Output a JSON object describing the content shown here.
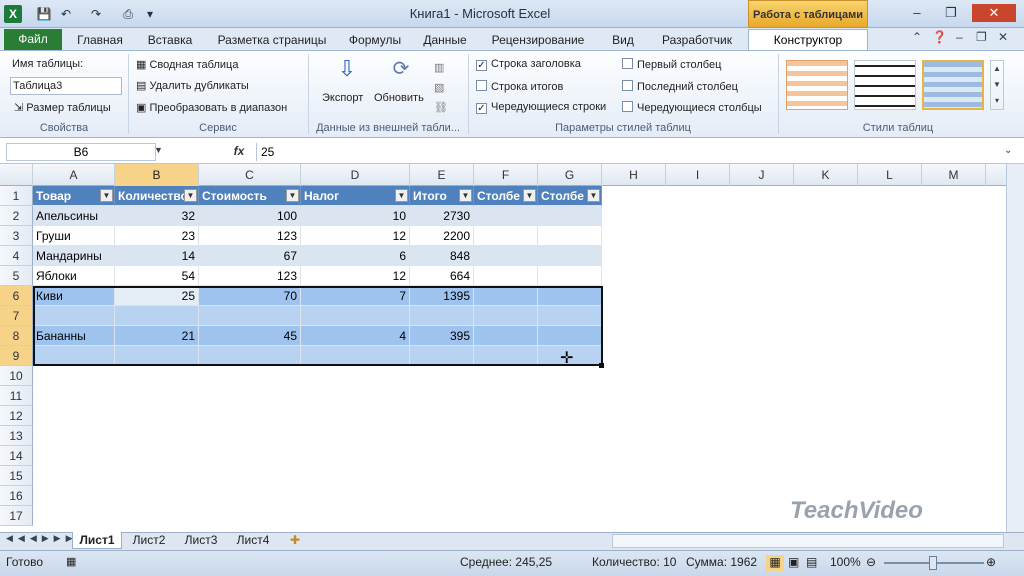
{
  "titlebar": {
    "title": "Книга1  -  Microsoft Excel",
    "context_group": "Работа с таблицами",
    "logo": "X"
  },
  "tabs": [
    "Файл",
    "Главная",
    "Вставка",
    "Разметка страницы",
    "Формулы",
    "Данные",
    "Рецензирование",
    "Вид",
    "Разработчик",
    "Конструктор"
  ],
  "ribbon": {
    "props_name_label": "Имя таблицы:",
    "table_name": "Таблица3",
    "resize": "Размер таблицы",
    "props_group": "Свойства",
    "pivot": "Сводная таблица",
    "remove_dups": "Удалить дубликаты",
    "convert": "Преобразовать в диапазон",
    "service_group": "Сервис",
    "export": "Экспорт",
    "refresh": "Обновить",
    "external_group": "Данные из внешней табли...",
    "opt_header": "Строка заголовка",
    "opt_totals": "Строка итогов",
    "opt_banded_rows": "Чередующиеся строки",
    "opt_first_col": "Первый столбец",
    "opt_last_col": "Последний столбец",
    "opt_banded_cols": "Чередующиеся столбцы",
    "options_group": "Параметры стилей таблиц",
    "styles_group": "Стили таблиц",
    "checked": {
      "header": true,
      "totals": false,
      "banded_rows": true,
      "first_col": false,
      "last_col": false,
      "banded_cols": false
    }
  },
  "formula_bar": {
    "cell_ref": "B6",
    "fx": "fx",
    "value": "25"
  },
  "columns": [
    "A",
    "B",
    "C",
    "D",
    "E",
    "F",
    "G",
    "H",
    "I",
    "J",
    "K",
    "L",
    "M"
  ],
  "row_numbers": [
    "1",
    "2",
    "3",
    "4",
    "5",
    "6",
    "7",
    "8",
    "9",
    "10",
    "11",
    "12",
    "13",
    "14",
    "15",
    "16",
    "17"
  ],
  "table": {
    "headers": [
      "Товар",
      "Количество",
      "Стоимость",
      "Налог",
      "Итого",
      "Столбе",
      "Столбе"
    ],
    "rows": [
      [
        "Апельсины",
        "32",
        "100",
        "10",
        "2730",
        "",
        ""
      ],
      [
        "Груши",
        "23",
        "123",
        "12",
        "2200",
        "",
        ""
      ],
      [
        "Мандарины",
        "14",
        "67",
        "6",
        "848",
        "",
        ""
      ],
      [
        "Яблоки",
        "54",
        "123",
        "12",
        "664",
        "",
        ""
      ],
      [
        "Киви",
        "25",
        "70",
        "7",
        "1395",
        "",
        ""
      ],
      [
        "",
        "",
        "",
        "",
        "",
        "",
        ""
      ],
      [
        "Бананны",
        "21",
        "45",
        "4",
        "395",
        "",
        ""
      ],
      [
        "",
        "",
        "",
        "",
        "",
        "",
        ""
      ]
    ]
  },
  "sheets": [
    "Лист1",
    "Лист2",
    "Лист3",
    "Лист4"
  ],
  "status": {
    "ready": "Готово",
    "average": "Среднее: 245,25",
    "count": "Количество: 10",
    "sum": "Сумма: 1962",
    "zoom": "100%"
  },
  "watermark": "TeachVideo"
}
